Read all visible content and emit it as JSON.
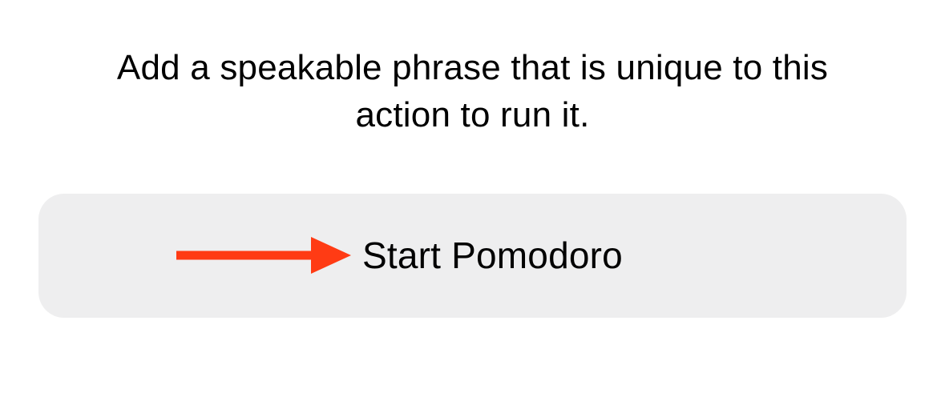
{
  "instruction": "Add a speakable phrase that is unique to this action to run it.",
  "phrase_input": {
    "value": "Start Pomodoro"
  },
  "annotation": {
    "arrow_color": "#ff3b14"
  }
}
